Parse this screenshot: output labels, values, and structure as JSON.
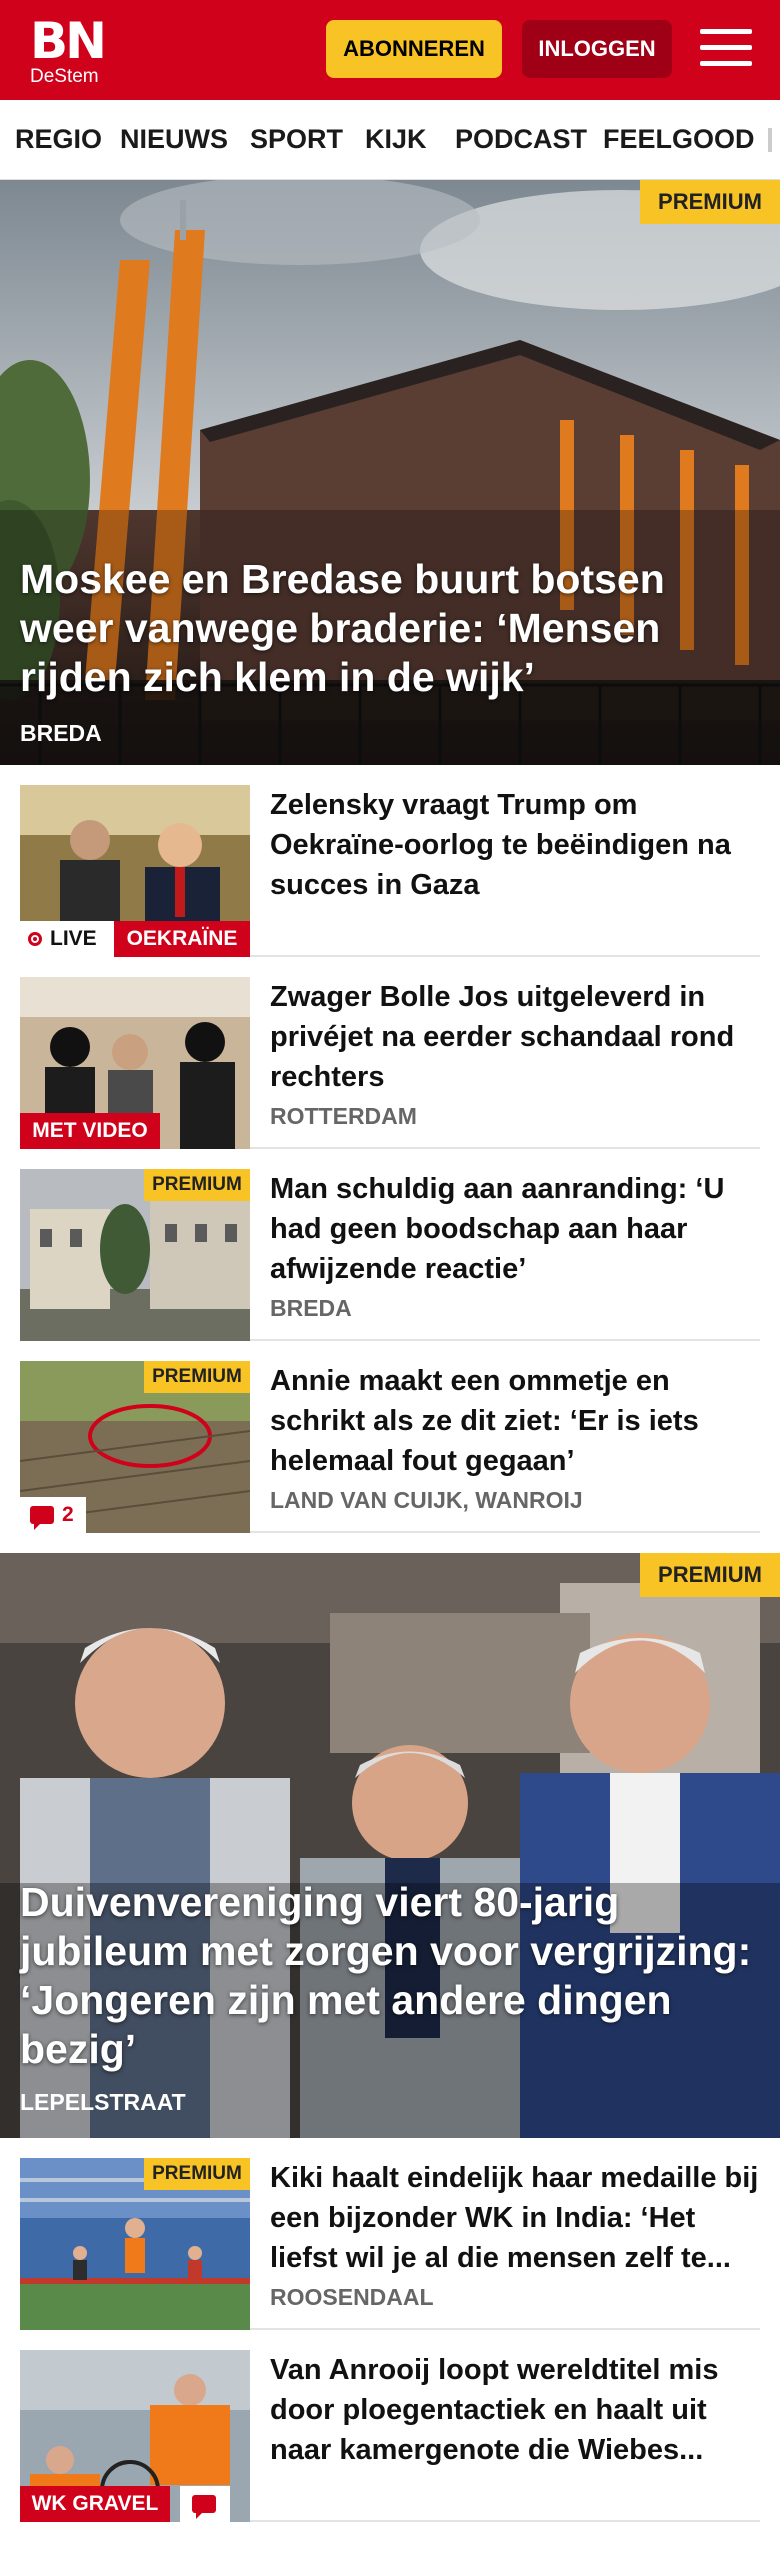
{
  "header": {
    "logo_main": "BN",
    "logo_sub": "DeStem",
    "subscribe_label": "ABONNEREN",
    "login_label": "INLOGGEN"
  },
  "nav": {
    "items": [
      "REGIO",
      "NIEUWS",
      "SPORT",
      "KIJK",
      "PODCAST",
      "FEELGOOD"
    ]
  },
  "hero1": {
    "premium": "PREMIUM",
    "title": "Moskee en Bredase buurt botsen weer vanwege braderie: ‘Mensen rijden zich klem in de wijk’",
    "location": "BREDA"
  },
  "articles": [
    {
      "title": "Zelensky vraagt Trump om Oekraïne-oorlog te beëindigen na succes in Gaza",
      "live": "LIVE",
      "tag": "OEKRAÏNE"
    },
    {
      "title": "Zwager Bolle Jos uitgeleverd in privéjet na eerder schandaal rond rechters",
      "location": "ROTTERDAM",
      "tag": "MET VIDEO"
    },
    {
      "title": "Man schuldig aan aanranding: ‘U had geen boodschap aan haar afwijzende reactie’",
      "location": "BREDA",
      "premium": "PREMIUM"
    },
    {
      "title": "Annie maakt een ommetje en schrikt als ze dit ziet: ‘Er is iets helemaal fout gegaan’",
      "location": "LAND VAN CUIJK, WANROIJ",
      "premium": "PREMIUM",
      "comments": "2"
    }
  ],
  "hero2": {
    "premium": "PREMIUM",
    "title": "Duivenvereniging viert 80-jarig jubileum met zorgen voor vergrijzing: ‘Jongeren zijn met andere dingen bezig’",
    "location": "LEPELSTRAAT"
  },
  "articles2": [
    {
      "title": "Kiki haalt eindelijk haar medaille bij een bijzonder WK in India: ‘Het liefst wil je al die mensen zelf te...",
      "location": "ROOSENDAAL",
      "premium": "PREMIUM"
    },
    {
      "title": "Van Anrooij loopt wereldtitel mis door ploegentactiek en haalt uit naar kamergenote die Wiebes...",
      "tag": "WK GRAVEL"
    }
  ],
  "colors": {
    "brand_red": "#d0021b",
    "premium_yellow": "#f7c325",
    "login_dark_red": "#a00016"
  }
}
